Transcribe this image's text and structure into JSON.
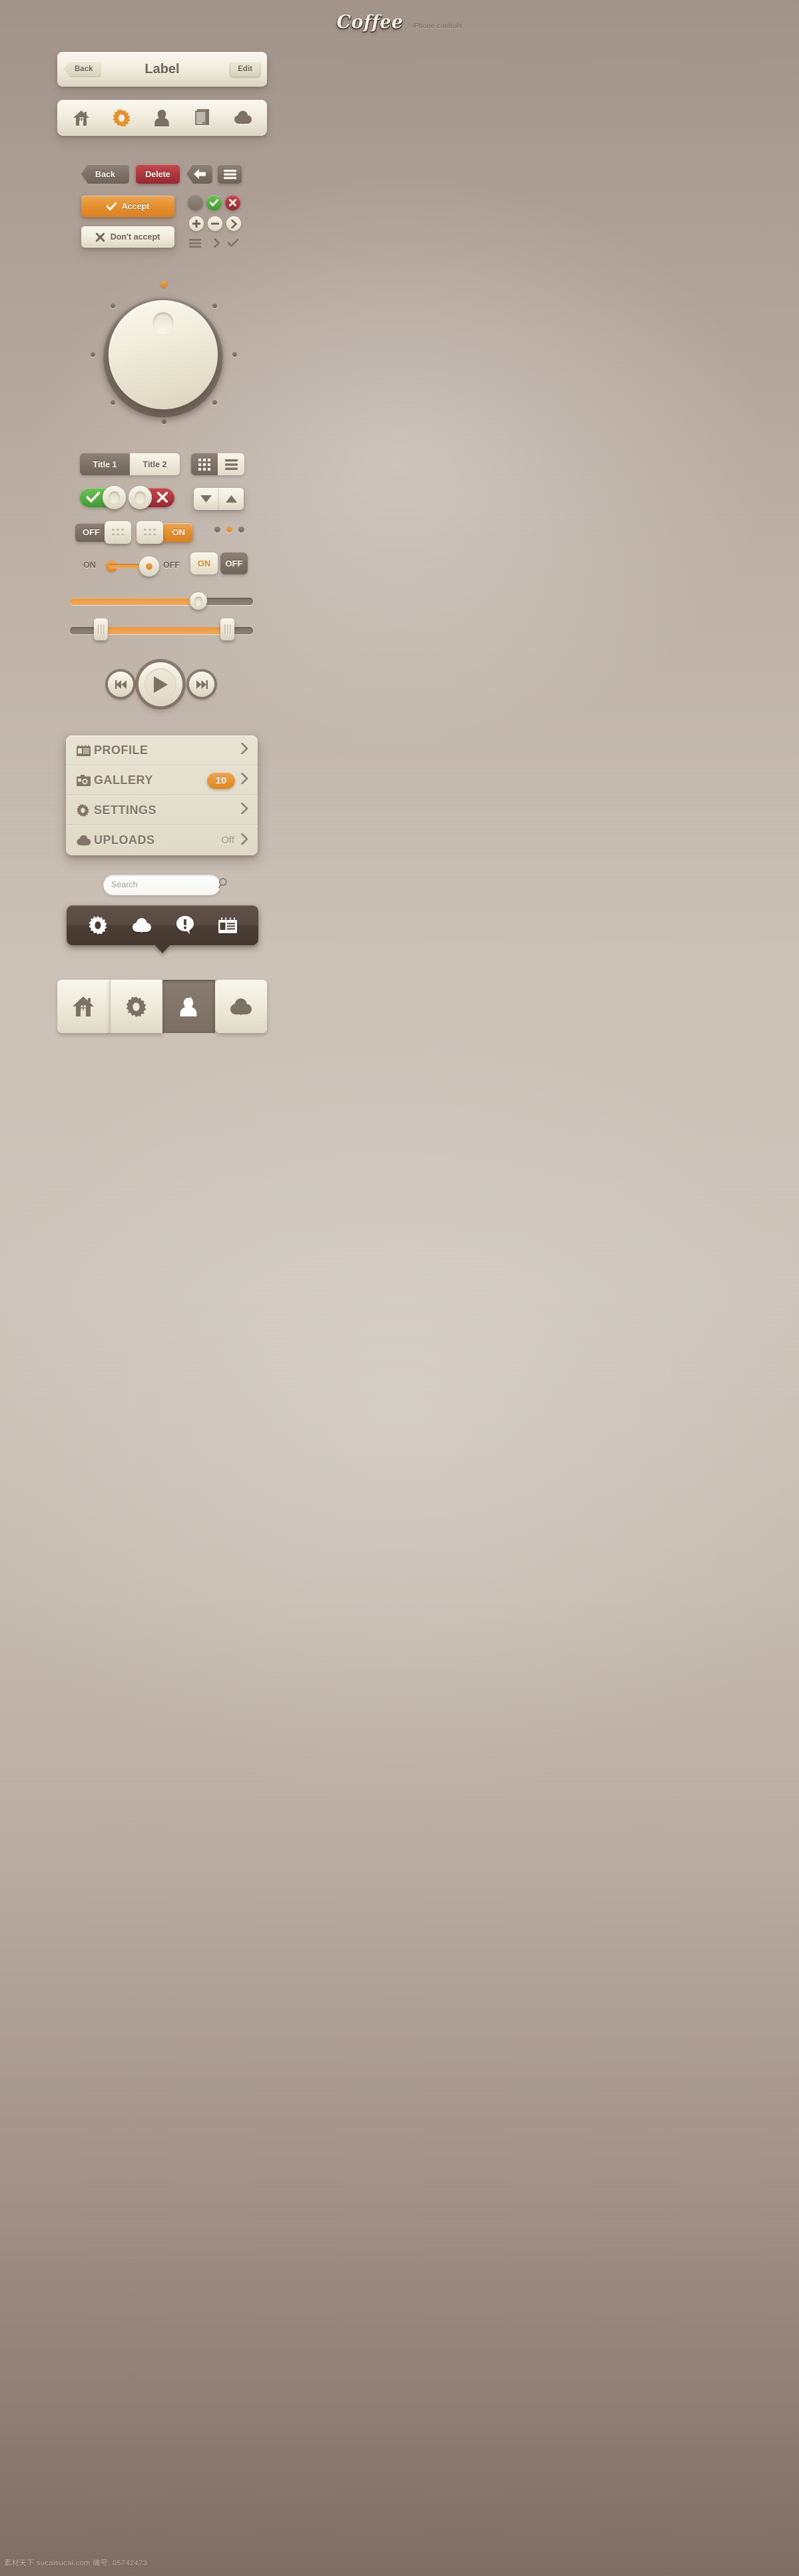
{
  "brand": {
    "logo": "Coffee",
    "subtitle": "iPhone controls"
  },
  "colors": {
    "orange": "#e8922f",
    "red": "#b03840",
    "green": "#54ad43",
    "brown": "#7d7165",
    "cream": "#f5f1e4",
    "dark_popover": "#4a3d34"
  },
  "navbar": {
    "back": "Back",
    "title": "Label",
    "edit": "Edit"
  },
  "icon_toolbar": {
    "items": [
      {
        "name": "home-icon",
        "active": false
      },
      {
        "name": "gear-icon",
        "active": true
      },
      {
        "name": "user-icon",
        "active": false
      },
      {
        "name": "document-icon",
        "active": false
      },
      {
        "name": "cloud-download-icon",
        "active": false
      }
    ]
  },
  "buttons": {
    "back": "Back",
    "delete": "Delete",
    "back_arrow_icon": "arrow-left-icon",
    "menu_icon": "hamburger-menu-icon",
    "accept": "Accept",
    "accept_icon": "check-icon",
    "dont_accept": "Don't accept",
    "dont_accept_icon": "cross-icon"
  },
  "status_dots": [
    {
      "name": "neutral-dot",
      "glyph": ""
    },
    {
      "name": "success-dot",
      "glyph": "check"
    },
    {
      "name": "error-dot",
      "glyph": "cross"
    }
  ],
  "steppers": [
    {
      "name": "plus-button",
      "glyph": "plus"
    },
    {
      "name": "minus-button",
      "glyph": "minus"
    },
    {
      "name": "next-button",
      "glyph": "chevron-right"
    }
  ],
  "plain_glyphs": [
    {
      "name": "list-icon"
    },
    {
      "name": "chevron-right-icon"
    },
    {
      "name": "check-icon"
    }
  ],
  "knob": {
    "name": "rotary-knob",
    "indicator_color": "#e2851f",
    "tick_count": 7
  },
  "segmented_titles": {
    "options": [
      {
        "label": "Title 1",
        "selected": true
      },
      {
        "label": "Title 2",
        "selected": false
      }
    ]
  },
  "segmented_view": {
    "options": [
      {
        "icon": "grid-view-icon",
        "selected": true
      },
      {
        "icon": "list-view-icon",
        "selected": false
      }
    ]
  },
  "toggles": [
    {
      "name": "toggle-accept",
      "state": "on",
      "icon": "check-icon"
    },
    {
      "name": "toggle-reject",
      "state": "off",
      "icon": "cross-icon"
    }
  ],
  "stepper_updown": {
    "down_icon": "triangle-down-icon",
    "up_icon": "triangle-up-icon"
  },
  "slide_switches": [
    {
      "name": "switch-off",
      "label": "OFF",
      "state": "off"
    },
    {
      "name": "switch-on",
      "label": "ON",
      "state": "on"
    }
  ],
  "pager": {
    "total": 3,
    "active_index": 1
  },
  "onoff_slider": {
    "left_label": "ON",
    "right_label": "OFF",
    "value_percent": 100
  },
  "onoff_buttons": {
    "on": "ON",
    "off": "OFF",
    "selected": "ON"
  },
  "sliders": [
    {
      "name": "progress-slider",
      "value_percent": 69
    },
    {
      "name": "range-slider",
      "start_percent": 16,
      "end_percent": 86
    }
  ],
  "media_controls": {
    "previous": "previous-track-icon",
    "play": "play-icon",
    "next": "next-track-icon"
  },
  "menu_list": {
    "rows": [
      {
        "icon": "id-card-icon",
        "label": "PROFILE",
        "badge": null,
        "value": null,
        "chevron": "chevron-right-icon"
      },
      {
        "icon": "camera-icon",
        "label": "GALLERY",
        "badge": "10",
        "value": null,
        "chevron": "chevron-right-icon"
      },
      {
        "icon": "gear-icon",
        "label": "SETTINGS",
        "badge": null,
        "value": null,
        "chevron": "chevron-right-icon"
      },
      {
        "icon": "cloud-upload-icon",
        "label": "UPLOADS",
        "badge": null,
        "value": "Off",
        "chevron": "chevron-right-icon"
      }
    ]
  },
  "search": {
    "placeholder": "Search",
    "value": "",
    "icon": "search-icon"
  },
  "popover": {
    "items": [
      {
        "icon": "gear-icon"
      },
      {
        "icon": "cloud-download-icon"
      },
      {
        "icon": "alert-bubble-icon"
      },
      {
        "icon": "id-card-icon"
      }
    ]
  },
  "tabbar": {
    "tabs": [
      {
        "icon": "home-icon",
        "active": false
      },
      {
        "icon": "gear-icon",
        "active": false
      },
      {
        "icon": "user-icon",
        "active": true
      },
      {
        "icon": "cloud-download-icon",
        "active": false
      }
    ]
  },
  "watermark": "素材天下 sucaisucai.com  编号: 05742473"
}
